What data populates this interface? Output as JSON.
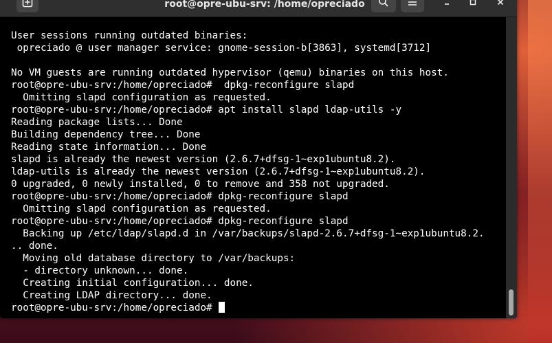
{
  "window": {
    "title": "root@opre-ubu-srv: /home/opreciado"
  },
  "headerbar": {
    "new_tab_icon": "plus-in-square",
    "search_icon": "magnifier",
    "menu_icon": "hamburger",
    "minimize_icon": "minimize",
    "maximize_icon": "maximize",
    "close_icon": "close"
  },
  "terminal": {
    "background": "#000000",
    "foreground": "#ffffff",
    "lines": [
      "",
      "User sessions running outdated binaries:",
      " opreciado @ user manager service: gnome-session-b[3863], systemd[3712]",
      "",
      "No VM guests are running outdated hypervisor (qemu) binaries on this host.",
      "root@opre-ubu-srv:/home/opreciado#  dpkg-reconfigure slapd",
      "  Omitting slapd configuration as requested.",
      "root@opre-ubu-srv:/home/opreciado# apt install slapd ldap-utils -y",
      "Reading package lists... Done",
      "Building dependency tree... Done",
      "Reading state information... Done",
      "slapd is already the newest version (2.6.7+dfsg-1~exp1ubuntu8.2).",
      "ldap-utils is already the newest version (2.6.7+dfsg-1~exp1ubuntu8.2).",
      "0 upgraded, 0 newly installed, 0 to remove and 358 not upgraded.",
      "root@opre-ubu-srv:/home/opreciado# dpkg-reconfigure slapd",
      "  Omitting slapd configuration as requested.",
      "root@opre-ubu-srv:/home/opreciado# dpkg-reconfigure slapd",
      "  Backing up /etc/ldap/slapd.d in /var/backups/slapd-2.6.7+dfsg-1~exp1ubuntu8.2.",
      ".. done.",
      "  Moving old database directory to /var/backups:",
      "  - directory unknown... done.",
      "  Creating initial configuration... done.",
      "  Creating LDAP directory... done."
    ],
    "prompt": "root@opre-ubu-srv:/home/opreciado#"
  },
  "colors": {
    "headerbar": "#2f2f2f",
    "button": "#444444",
    "scroll_thumb": "#a8a8a8"
  }
}
